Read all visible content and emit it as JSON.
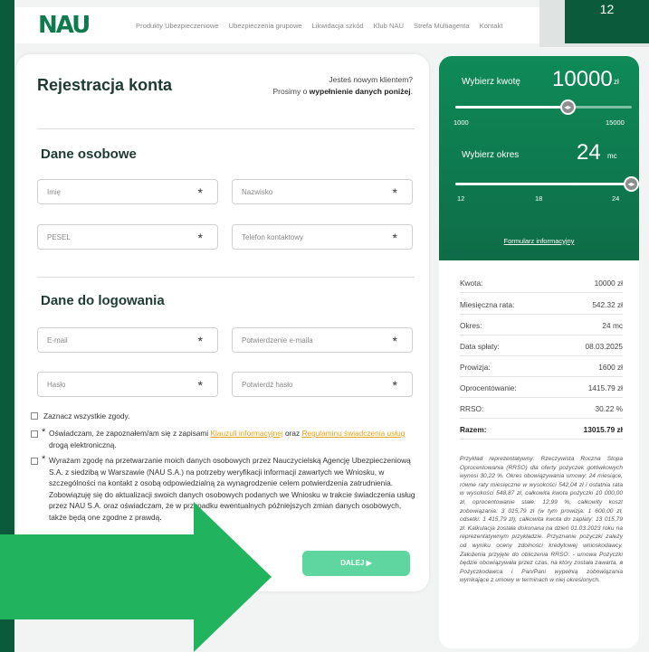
{
  "topbar": {
    "badge": "12"
  },
  "nav": {
    "logo": "NAU",
    "links": [
      "Produkty Ubezpieczeniowe",
      "Ubezpieczenia grupowe",
      "Likwidacja szkód",
      "Klub NAU",
      "Strefa Multiagenta",
      "Kontakt"
    ]
  },
  "form": {
    "title": "Rejestracja konta",
    "new_client_line1": "Jesteś nowym klientem?",
    "new_client_line2_pre": "Prosimy o ",
    "new_client_line2_bold": "wypełnienie danych poniżej",
    "new_client_line2_post": ".",
    "section_personal": "Dane osobowe",
    "section_login": "Dane do logowania",
    "fields": {
      "first_name": "Imię",
      "last_name": "Nazwisko",
      "pesel": "PESEL",
      "phone": "Telefon kontaktowy",
      "email": "E-mail",
      "email_confirm": "Potwierdzenie e-maila",
      "password": "Hasło",
      "password_confirm": "Potwierdź hasło"
    },
    "required_mark": "*",
    "consent_all": "Zaznacz wszystkie zgody.",
    "consent1_pre": "Oświadczam, że zapoznałem/am się z zapisami ",
    "consent1_link1": "Klauzuli informacyjnej",
    "consent1_mid": " oraz ",
    "consent1_link2": "Regulaminu świadczenia usług",
    "consent1_post": " drogą elektroniczną.",
    "consent2": "Wyrażam zgodę na przetwarzanie moich danych osobowych przez Nauczycielską Agencję Ubezpieczeniową S.A. z siedzibą w Warszawie (NAU S.A.) na potrzeby weryfikacji informacji zawartych we Wniosku, w szczególności na kontakt z osobą odpowiedzialną za wynagrodzenie celem potwierdzenia zatrudnienia. Zobowiązuję się do aktualizacji swoich danych osobowych podanych we Wniosku w trakcie świadczenia usług przez NAU S.A. oraz oświadczam, że w przypadku ewentualnych późniejszych zmian danych osobowych, także będą one zgodne z prawdą.",
    "next_button": "DALEJ ▶"
  },
  "calculator": {
    "amount_label": "Wybierz kwotę",
    "amount_value": "10000",
    "amount_unit": "zł",
    "amount_min": "1000",
    "amount_max": "15000",
    "amount_fraction": 0.64,
    "period_label": "Wybierz okres",
    "period_value": "24",
    "period_unit": "mc",
    "period_ticks": [
      "12",
      "18",
      "24"
    ],
    "period_fraction": 1.0,
    "info_link": "Formularz informacyjny",
    "summary": [
      {
        "k": "Kwota:",
        "v": "10000 zł"
      },
      {
        "k": "Miesięczna rata:",
        "v": "542.32 zł"
      },
      {
        "k": "Okres:",
        "v": "24 mc"
      },
      {
        "k": "Data spłaty:",
        "v": "08.03.2025"
      },
      {
        "k": "Prowizja:",
        "v": "1600 zł"
      },
      {
        "k": "Oprocentowanie:",
        "v": "1415.79 zł"
      },
      {
        "k": "RRSO:",
        "v": "30.22 %"
      },
      {
        "k": "Razem:",
        "v": "13015.79 zł"
      }
    ],
    "disclaimer": "Przykład reprezentatywny: Rzeczywista Roczna Stopa Oprocentowania (RRSO) dla oferty pożyczek gotówkowych wynosi 30,22 %. Okres obowiązywania umowy: 24 miesiące, równe raty miesięczne w wysokości 542,04 zł i ostatnia rata w wysokości 548,87 zł, całkowita kwota pożyczki 10 000,00 zł, oprocentowanie stałe: 12,99 %, całkowity koszt zobowiązania: 3 015,79 zł (w tym prowizja: 1 600,00 zł, odsetki: 1 415,79 zł), całkowita kwota do zapłaty: 13 015,79 zł. Kalkulacja została dokonana na dzień 01.03.2023 roku na reprezentatywnym przykładzie. Przyznanie pożyczki zależy od wyniku oceny zdolności kredytowej wnioskodawcy. Założenia przyjęte do obliczenia RRSO: - umowa Pożyczki będzie obowiązywała przez czas, na który została zawarta, a Pożyczkodawca i Pan/Pani wypełnią zobowiązania wynikające z umowy w terminach w niej określonych."
  },
  "colors": {
    "brand": "#0f7a4e",
    "accent_link": "#e8a317",
    "button": "#5fd6a0",
    "arrow": "#22b35e"
  }
}
